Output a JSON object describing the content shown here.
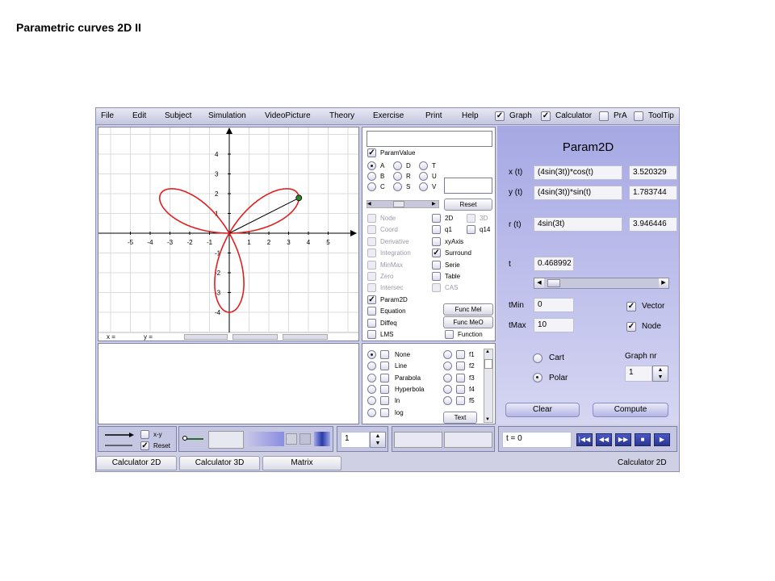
{
  "page_title": "Parametric curves 2D  II",
  "menu": [
    "File",
    "Edit",
    "Subject",
    "Simulation",
    "VideoPicture",
    "Theory",
    "Exercise",
    "Print",
    "Help"
  ],
  "toggles": [
    {
      "label": "Graph",
      "checked": true
    },
    {
      "label": "Calculator",
      "checked": true
    },
    {
      "label": "PrA",
      "checked": false
    },
    {
      "label": "ToolTip",
      "checked": false
    }
  ],
  "graph": {
    "x_ticks": [
      "-5",
      "-4",
      "-3",
      "-2",
      "-1",
      "1",
      "2",
      "3",
      "4",
      "5"
    ],
    "y_ticks": [
      "4",
      "3",
      "2",
      "1",
      "-1",
      "-2",
      "-3",
      "-4"
    ],
    "coord_x": "x =",
    "coord_y": "y =",
    "curve_color": "#e02020",
    "t": 0.468992
  },
  "middle": {
    "param_value_label": "ParamValue",
    "radios": [
      {
        "label": "A",
        "on": true
      },
      {
        "label": "D",
        "on": false
      },
      {
        "label": "T",
        "on": false
      },
      {
        "label": "B",
        "on": false
      },
      {
        "label": "R",
        "on": false
      },
      {
        "label": "U",
        "on": false
      },
      {
        "label": "C",
        "on": false
      },
      {
        "label": "S",
        "on": false
      },
      {
        "label": "V",
        "on": false
      }
    ],
    "reset": "Reset",
    "left_checks": [
      {
        "label": "Node",
        "checked": false,
        "disabled": true
      },
      {
        "label": "Coord",
        "checked": false,
        "disabled": true
      },
      {
        "label": "Derivative",
        "checked": false,
        "disabled": true
      },
      {
        "label": "Integration",
        "checked": false,
        "disabled": true
      },
      {
        "label": "MinMax",
        "checked": false,
        "disabled": true
      },
      {
        "label": "Zero",
        "checked": false,
        "disabled": true
      },
      {
        "label": "Intersec",
        "checked": false,
        "disabled": true
      },
      {
        "label": "Param2D",
        "checked": true,
        "disabled": false
      },
      {
        "label": "Equation",
        "checked": false,
        "disabled": false
      },
      {
        "label": "Diffeq",
        "checked": false,
        "disabled": false
      },
      {
        "label": "LMS",
        "checked": false,
        "disabled": false
      }
    ],
    "right_checks": [
      {
        "label": "2D",
        "checked": false,
        "disabled": false
      },
      {
        "label": "q1",
        "checked": false,
        "disabled": false
      },
      {
        "label": "xyAxis",
        "checked": false,
        "disabled": false
      },
      {
        "label": "Surround",
        "checked": true,
        "disabled": false
      },
      {
        "label": "Serie",
        "checked": false,
        "disabled": false
      },
      {
        "label": "Table",
        "checked": false,
        "disabled": false
      },
      {
        "label": "CAS",
        "checked": false,
        "disabled": true
      }
    ],
    "check_3d": "3D",
    "check_q14": "q14",
    "func_mel": "Func Mel",
    "func_meo": "Func MeO",
    "function": "Function"
  },
  "fit": {
    "left": [
      {
        "label": "None",
        "on": true
      },
      {
        "label": "Line",
        "on": false
      },
      {
        "label": "Parabola",
        "on": false
      },
      {
        "label": "Hyperbola",
        "on": false
      },
      {
        "label": "ln",
        "on": false
      },
      {
        "label": "log",
        "on": false
      }
    ],
    "right": [
      "f1",
      "f2",
      "f3",
      "f4",
      "f5"
    ],
    "text_btn": "Text"
  },
  "param": {
    "title": "Param2D",
    "x_label": "x (t)",
    "x_expr": "(4sin(3t))*cos(t)",
    "x_val": "3.520329",
    "y_label": "y (t)",
    "y_expr": "(4sin(3t))*sin(t)",
    "y_val": "1.783744",
    "r_label": "r (t)",
    "r_expr": "4sin(3t)",
    "r_val": "3.946446",
    "t_label": "t",
    "t_val": "0.468992",
    "tmin_label": "tMin",
    "tmin_val": "0",
    "tmax_label": "tMax",
    "tmax_val": "10",
    "vector": "Vector",
    "node": "Node",
    "cart": "Cart",
    "polar": "Polar",
    "graph_nr_label": "Graph nr",
    "graph_nr": "1",
    "clear": "Clear",
    "compute": "Compute"
  },
  "bottom": {
    "xy": "x-y",
    "reset": "Reset",
    "spin": "1",
    "t_display": "t = 0"
  },
  "tabs": [
    "Calculator  2D",
    "Calculator  3D",
    "Matrix"
  ],
  "status": "Calculator 2D"
}
